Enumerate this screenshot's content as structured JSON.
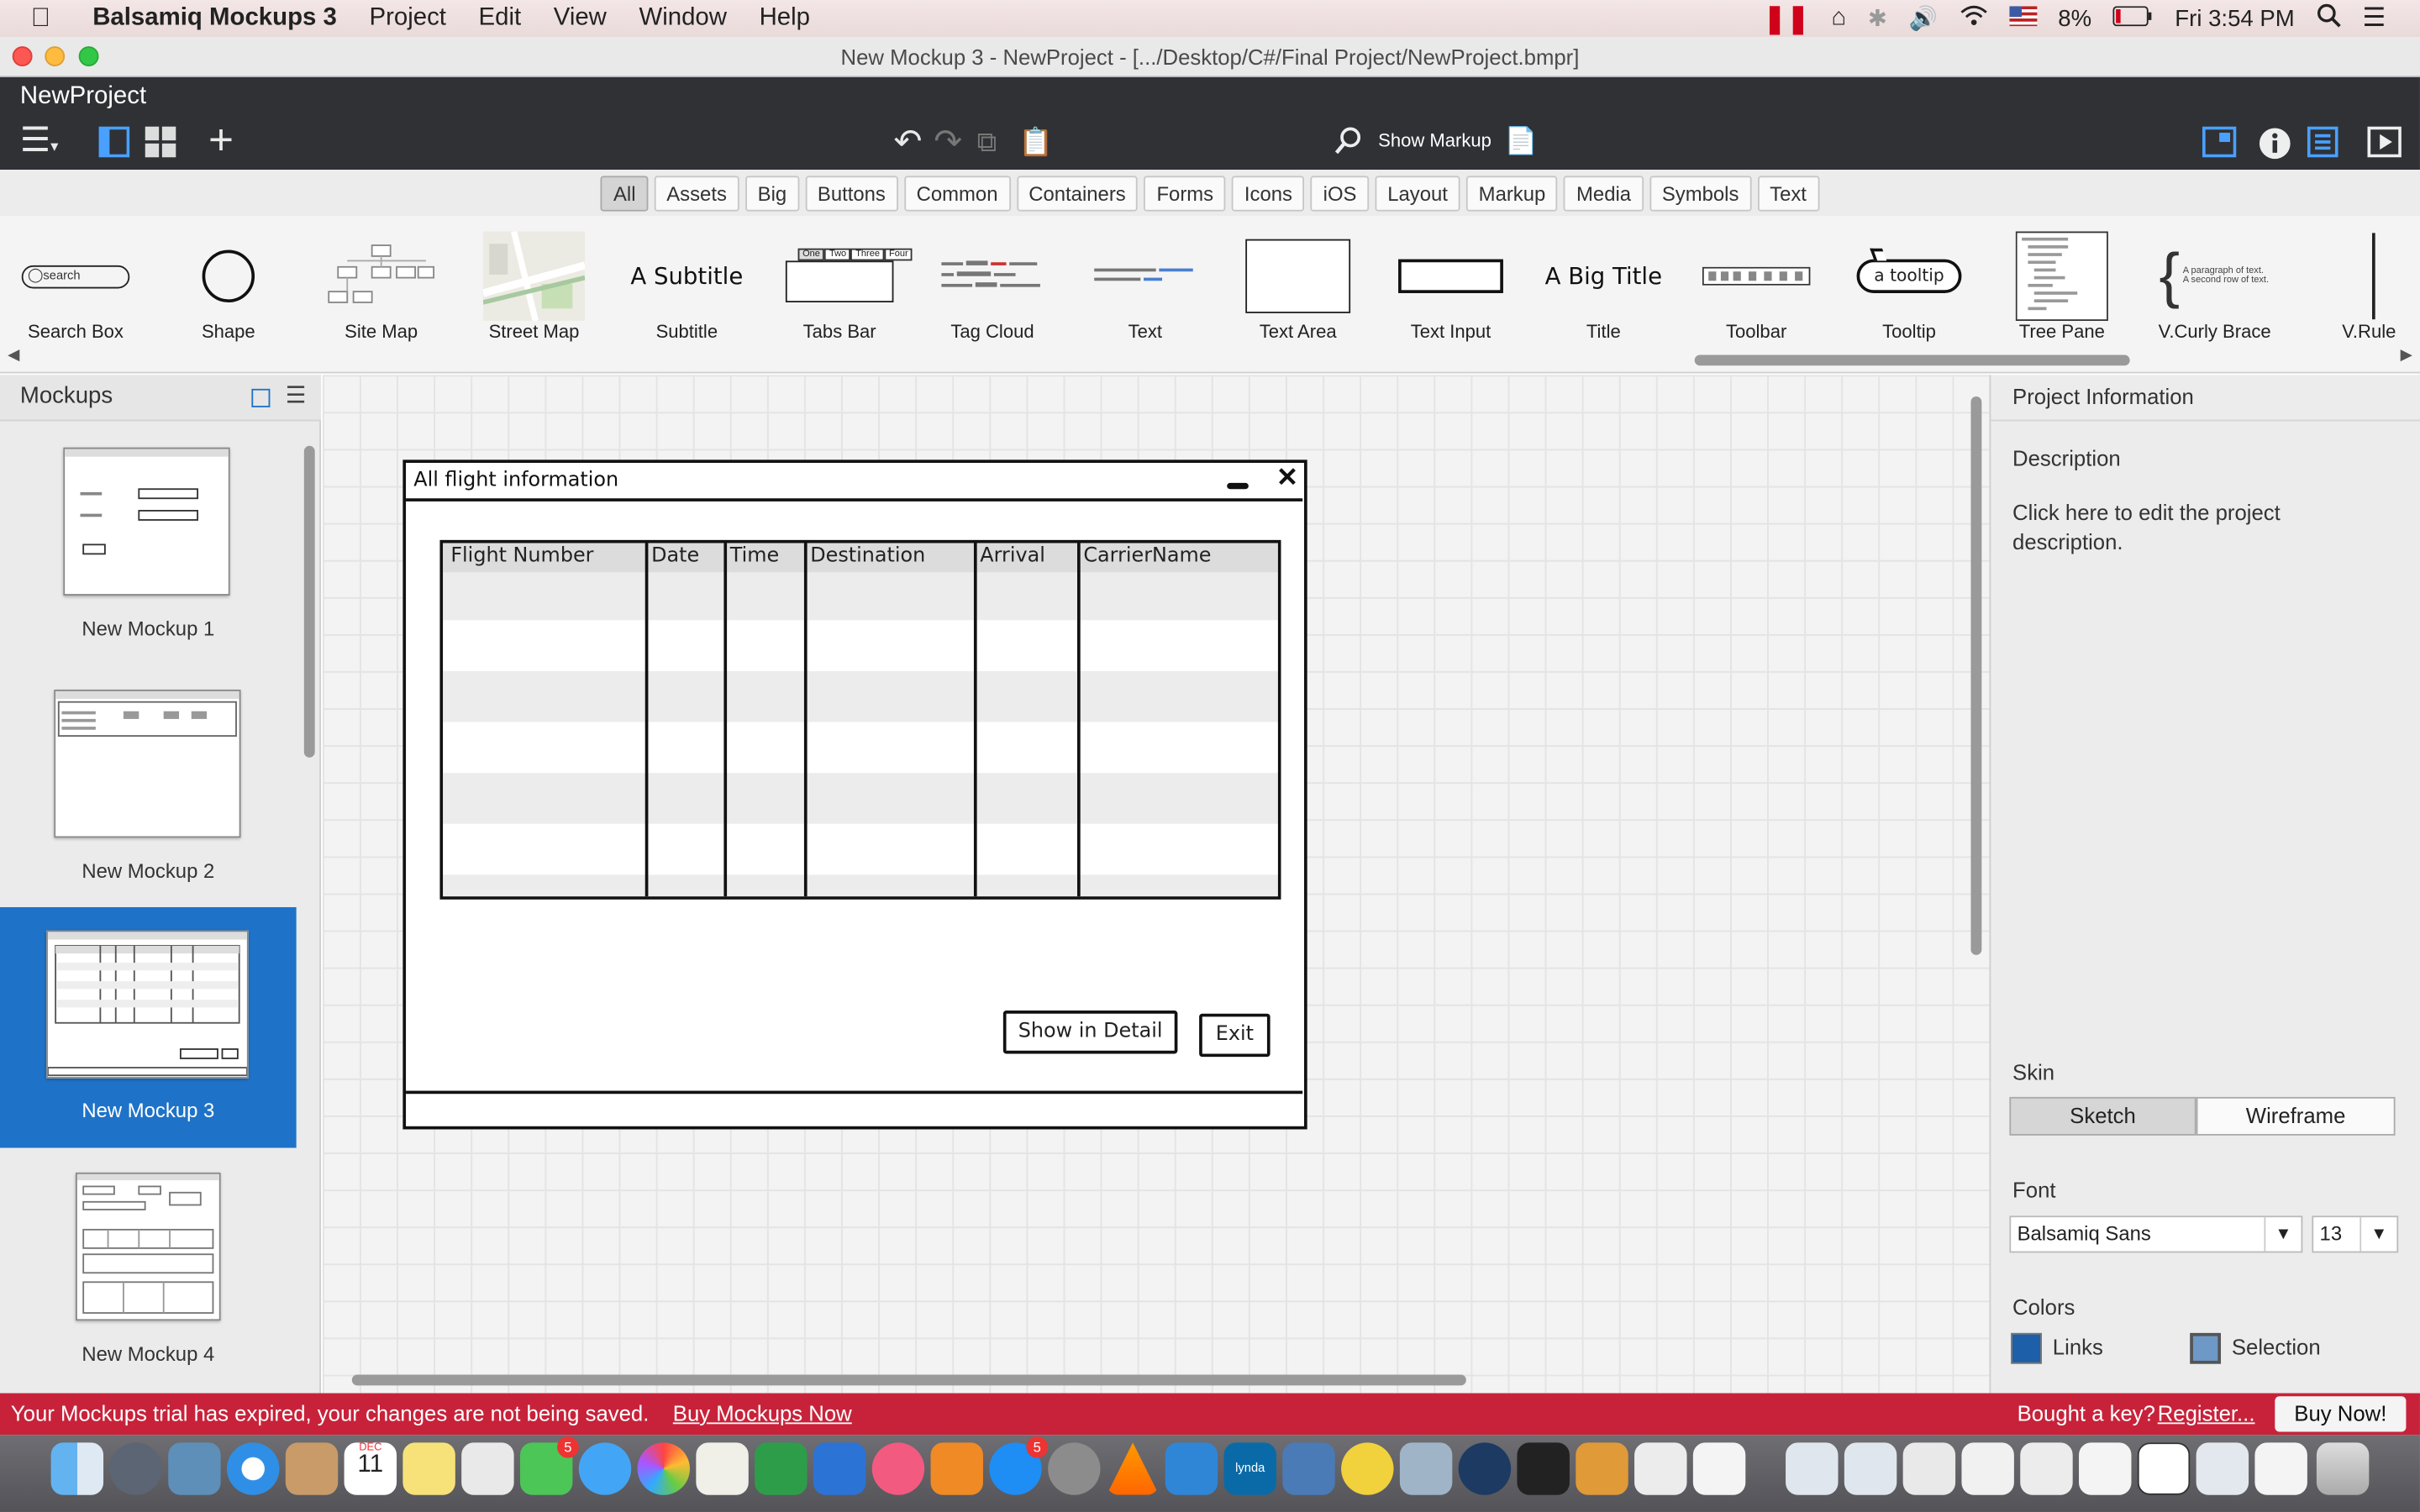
{
  "menubar": {
    "app_name": "Balsamiq Mockups 3",
    "items": [
      "Project",
      "Edit",
      "View",
      "Window",
      "Help"
    ],
    "battery": "8%",
    "clock": "Fri 3:54 PM"
  },
  "window": {
    "title": "New Mockup 3 - NewProject - [.../Desktop/C#/Final Project/NewProject.bmpr]"
  },
  "toolbar": {
    "project_name": "NewProject",
    "show_markup": "Show Markup"
  },
  "filters": [
    "All",
    "Assets",
    "Big",
    "Buttons",
    "Common",
    "Containers",
    "Forms",
    "Icons",
    "iOS",
    "Layout",
    "Markup",
    "Media",
    "Symbols",
    "Text"
  ],
  "library": [
    {
      "label": "Search Box",
      "icon": "search-box"
    },
    {
      "label": "Shape",
      "icon": "circle"
    },
    {
      "label": "Site Map",
      "icon": "site-map"
    },
    {
      "label": "Street Map",
      "icon": "street-map"
    },
    {
      "label": "Subtitle",
      "icon": "subtitle"
    },
    {
      "label": "Tabs Bar",
      "icon": "tabs-bar"
    },
    {
      "label": "Tag Cloud",
      "icon": "tag-cloud"
    },
    {
      "label": "Text",
      "icon": "text"
    },
    {
      "label": "Text Area",
      "icon": "text-area"
    },
    {
      "label": "Text Input",
      "icon": "text-input"
    },
    {
      "label": "Title",
      "icon": "title"
    },
    {
      "label": "Toolbar",
      "icon": "toolbar"
    },
    {
      "label": "Tooltip",
      "icon": "tooltip"
    },
    {
      "label": "Tree Pane",
      "icon": "tree-pane"
    },
    {
      "label": "V.Curly Brace",
      "icon": "curly-brace"
    },
    {
      "label": "V.Rule",
      "icon": "v-rule"
    }
  ],
  "library_previews": {
    "search_placeholder": "search",
    "subtitle": "A Subtitle",
    "title": "A Big Title",
    "tooltip": "a tooltip",
    "tabs": [
      "One",
      "Two",
      "Three",
      "Four"
    ],
    "curly_text": [
      "A paragraph of text.",
      "A second row of text."
    ]
  },
  "mockups_panel": {
    "title": "Mockups",
    "items": [
      "New Mockup 1",
      "New Mockup 2",
      "New Mockup 3",
      "New Mockup 4"
    ],
    "selected": "New Mockup 3"
  },
  "sketch": {
    "window_title": "All flight information",
    "columns": [
      "Flight Number",
      "Date",
      "Time",
      "Destination",
      "Arrival",
      "CarrierName"
    ],
    "buttons": {
      "detail": "Show in Detail",
      "exit": "Exit"
    }
  },
  "properties": {
    "header": "Project Information",
    "description_label": "Description",
    "description_text": "Click here to edit the project description.",
    "skin_label": "Skin",
    "skin_options": [
      "Sketch",
      "Wireframe"
    ],
    "skin_selected": "Sketch",
    "font_label": "Font",
    "font_name": "Balsamiq Sans",
    "font_size": "13",
    "colors_label": "Colors",
    "color_links": "Links",
    "color_selection": "Selection",
    "link_color": "#1d5fa8"
  },
  "trial": {
    "message": "Your Mockups trial has expired, your changes are not being saved.",
    "buy_link": "Buy Mockups Now",
    "bought_key": "Bought a key?",
    "register": "Register...",
    "buy_now": "Buy Now!"
  },
  "dock": {
    "calendar_day": "11",
    "calendar_month": "DEC",
    "badge_facetime": "5",
    "badge_appstore": "5"
  },
  "colors": {
    "accent": "#1e73c8",
    "trial_bar": "#c8223a",
    "toolbar_bg": "#2f3135"
  }
}
